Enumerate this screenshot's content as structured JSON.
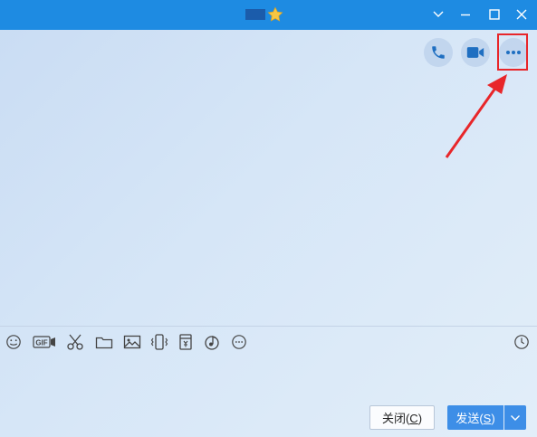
{
  "window": {
    "title_icon": "star-icon",
    "controls": [
      "minimize-chevron-icon",
      "minimize-icon",
      "maximize-icon",
      "close-icon"
    ]
  },
  "header_actions": [
    "phone-icon",
    "video-camera-icon",
    "more-icon"
  ],
  "annotation": {
    "color": "#e8262a"
  },
  "toolbar": {
    "left_tools": [
      "emoji-icon",
      "gif-icon",
      "scissors-icon",
      "folder-icon",
      "image-icon",
      "shake-icon",
      "red-packet-icon",
      "music-icon",
      "more-icon"
    ],
    "right_tools": [
      "history-clock-icon"
    ],
    "gif_label": "GIF"
  },
  "buttons": {
    "close_pre": "关闭(",
    "close_key": "C",
    "close_post": ")",
    "send_pre": "发送(",
    "send_key": "S",
    "send_post": ")"
  },
  "colors": {
    "titlebar": "#1e8be2",
    "accent": "#3d8ee7",
    "icon": "#1f6fc1"
  }
}
